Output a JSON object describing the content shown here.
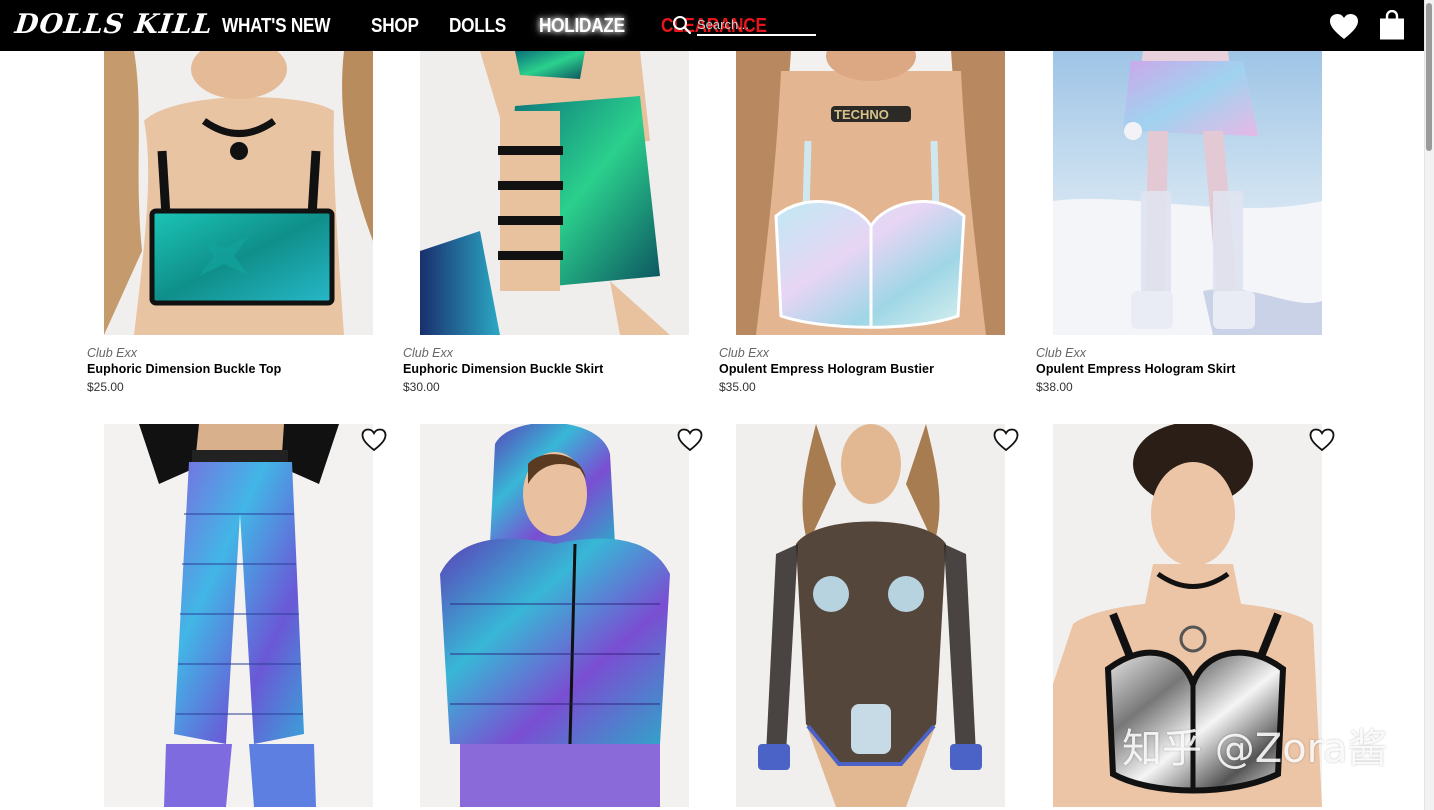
{
  "header": {
    "logo": "DOLLS KILL",
    "nav": [
      "WHAT'S NEW",
      "SHOP",
      "DOLLS",
      "HOLIDAZE",
      "CLEARANCE"
    ],
    "search_placeholder": "Search...",
    "icons": {
      "search": "search-icon",
      "wishlist": "heart-icon",
      "cart": "shopping-bag-icon"
    },
    "colors": {
      "bar": "#000000",
      "clearance": "#e4161b"
    }
  },
  "products_row1": [
    {
      "brand": "Club Exx",
      "name": "Euphoric Dimension Buckle Top",
      "price": "$25.00"
    },
    {
      "brand": "Club Exx",
      "name": "Euphoric Dimension Buckle Skirt",
      "price": "$30.00"
    },
    {
      "brand": "Club Exx",
      "name": "Opulent Empress Hologram Bustier",
      "price": "$35.00"
    },
    {
      "brand": "Club Exx",
      "name": "Opulent Empress Hologram Skirt",
      "price": "$38.00"
    }
  ],
  "products_row2": [
    {
      "wishlist_icon": "heart-outline-icon"
    },
    {
      "wishlist_icon": "heart-outline-icon"
    },
    {
      "wishlist_icon": "heart-outline-icon"
    },
    {
      "wishlist_icon": "heart-outline-icon"
    }
  ],
  "watermark": "知乎 @Zora酱"
}
